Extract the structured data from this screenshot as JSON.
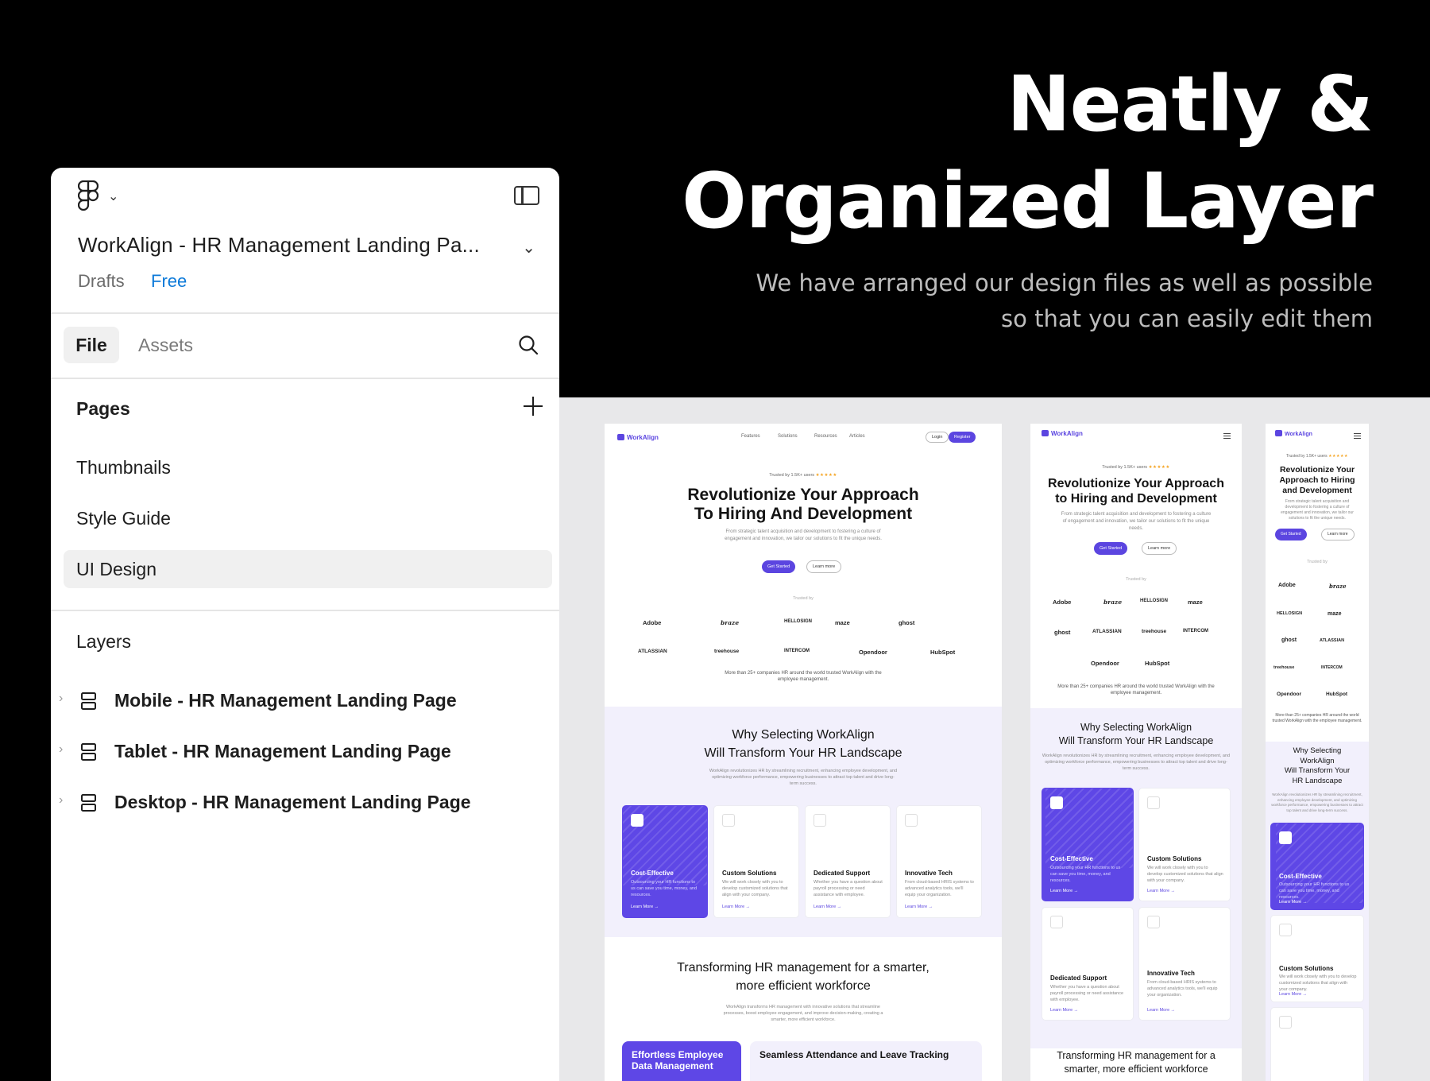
{
  "hero": {
    "title_line1": "Neatly &",
    "title_line2": "Organized Layer",
    "subtitle_line1": "We have arranged our design files as well as possible",
    "subtitle_line2": "so that you can easily edit them"
  },
  "panel": {
    "file_title": "WorkAlign - HR Management Landing Pa...",
    "location": "Drafts",
    "plan": "Free",
    "tabs": {
      "file": "File",
      "assets": "Assets"
    },
    "pages_heading": "Pages",
    "pages": [
      {
        "label": "Thumbnails"
      },
      {
        "label": "Style Guide"
      },
      {
        "label": "UI Design",
        "selected": true
      }
    ],
    "layers_heading": "Layers",
    "layers": [
      {
        "label": "Mobile - HR Management Landing Page"
      },
      {
        "label": "Tablet - HR Management Landing Page"
      },
      {
        "label": "Desktop - HR Management Landing Page"
      }
    ]
  },
  "mock": {
    "brand": "WorkAlign",
    "nav": [
      "Features",
      "Solutions",
      "Resources",
      "Articles"
    ],
    "login": "Login",
    "register": "Register",
    "trusted_by_users": "Trusted by 1.5K+ users",
    "stars": "★★★★★",
    "hero_desktop": [
      "Revolutionize Your Approach",
      "To Hiring And Development"
    ],
    "hero_tablet": [
      "Revolutionize Your Approach",
      "to Hiring and Development"
    ],
    "hero_mobile": [
      "Revolutionize Your",
      "Approach to Hiring",
      "and Development"
    ],
    "hero_desc": "From strategic talent acquisition and development to fostering a culture of engagement and innovation, we tailor our solutions to fit the unique needs.",
    "get_started": "Get Started",
    "learn_more": "Learn more",
    "trusted_by": "Trusted by",
    "logos": [
      "Adobe",
      "braze",
      "HELLOSIGN",
      "maze",
      "ghost",
      "ATLASSIAN",
      "treehouse",
      "INTERCOM",
      "Opendoor",
      "HubSpot"
    ],
    "companies_note": "More than 25+ companies HR around the world trusted WorkAlign with the employee management.",
    "why_desktop": [
      "Why Selecting WorkAlign",
      "Will Transform Your HR Landscape"
    ],
    "why_mobile": [
      "Why Selecting",
      "WorkAlign",
      "Will Transform Your",
      "HR Landscape"
    ],
    "why_desc": "WorkAlign revolutionizes HR by streamlining recruitment, enhancing employee development, and optimizing workforce performance, empowering businesses to attract top talent and drive long-term success.",
    "cards": [
      {
        "title": "Cost-Effective",
        "desc": "Outsourcing your HR functions to us can save you time, money, and resources."
      },
      {
        "title": "Custom Solutions",
        "desc": "We will work closely with you to develop customized solutions that align with your company."
      },
      {
        "title": "Dedicated Support",
        "desc": "Whether you have a question about payroll processing or need assistance with employee."
      },
      {
        "title": "Innovative Tech",
        "desc": "From cloud-based HRIS systems to advanced analytics tools, we'll equip your organization."
      }
    ],
    "learn_more_link": "Learn More →",
    "transform_desktop": [
      "Transforming HR management for a smarter,",
      "more efficient workforce"
    ],
    "transform_tablet": [
      "Transforming HR management for a",
      "smarter, more efficient workforce"
    ],
    "transform_desc": "WorkAlign transforms HR management with innovative solutions that streamline processes, boost employee engagement, and improve decision-making, creating a smarter, more efficient workforce.",
    "features": [
      {
        "title": "Effortless Employee Data Management"
      },
      {
        "title": "Seamless Attendance and Leave Tracking"
      }
    ],
    "accent": "#5b45e0"
  }
}
